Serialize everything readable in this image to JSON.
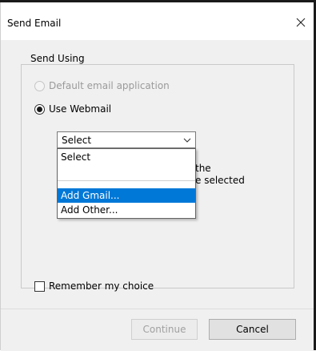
{
  "window": {
    "title": "Send Email",
    "close_symbol": "✕"
  },
  "group": {
    "legend": "Send Using",
    "options": [
      {
        "label": "Default email application",
        "selected": false,
        "enabled": false
      },
      {
        "label": "Use Webmail",
        "selected": true,
        "enabled": true
      }
    ]
  },
  "webmail_select": {
    "value": "Select",
    "options": [
      "Select",
      "",
      "Add Gmail...",
      "Add Other..."
    ],
    "highlighted": "Add Gmail..."
  },
  "description_fragment": {
    "line1": "the",
    "line2": "e selected"
  },
  "remember": {
    "label": "Remember my choice",
    "checked": false
  },
  "buttons": {
    "continue": "Continue",
    "cancel": "Cancel"
  },
  "colors": {
    "highlight": "#0078d7",
    "dialog_bg": "#f0f0f0"
  }
}
